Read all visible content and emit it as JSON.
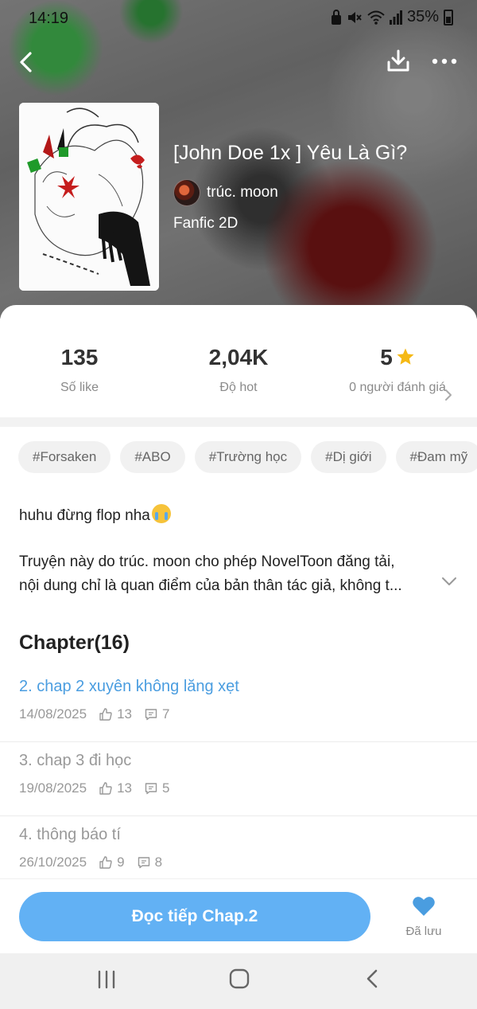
{
  "status_bar": {
    "time": "14:19",
    "battery": "35%"
  },
  "colors": {
    "accent": "#62b1f4",
    "link": "#4a9de0",
    "star": "#f5b915",
    "heart": "#4a9de0"
  },
  "book": {
    "title": "[John Doe 1x ] Yêu Là Gì?",
    "author": "trúc. moon",
    "genre": "Fanfic 2D"
  },
  "stats": [
    {
      "value": "135",
      "label": "Số like"
    },
    {
      "value": "2,04K",
      "label": "Độ hot"
    },
    {
      "value": "5",
      "label": "0 người đánh giá"
    }
  ],
  "tags": [
    "#Forsaken",
    "#ABO",
    "#Trường học",
    "#Dị giới",
    "#Đam mỹ"
  ],
  "description": {
    "line1": "huhu đừng flop nha",
    "line2": "Truyện này do trúc. moon cho phép NovelToon đăng tải,",
    "line3": "nội dung chỉ là quan điểm của bản thân tác giả, không t..."
  },
  "chapters_heading": "Chapter(16)",
  "chapters": [
    {
      "title": "2. chap 2 xuyên không lăng xẹt",
      "date": "14/08/2025",
      "likes": "13",
      "comments": "7"
    },
    {
      "title": "3. chap 3 đi học",
      "date": "19/08/2025",
      "likes": "13",
      "comments": "5"
    },
    {
      "title": "4. thông báo tí",
      "date": "26/10/2025",
      "likes": "9",
      "comments": "8"
    }
  ],
  "actions": {
    "read_label": "Đọc tiếp Chap.2",
    "saved_label": "Đã lưu"
  }
}
